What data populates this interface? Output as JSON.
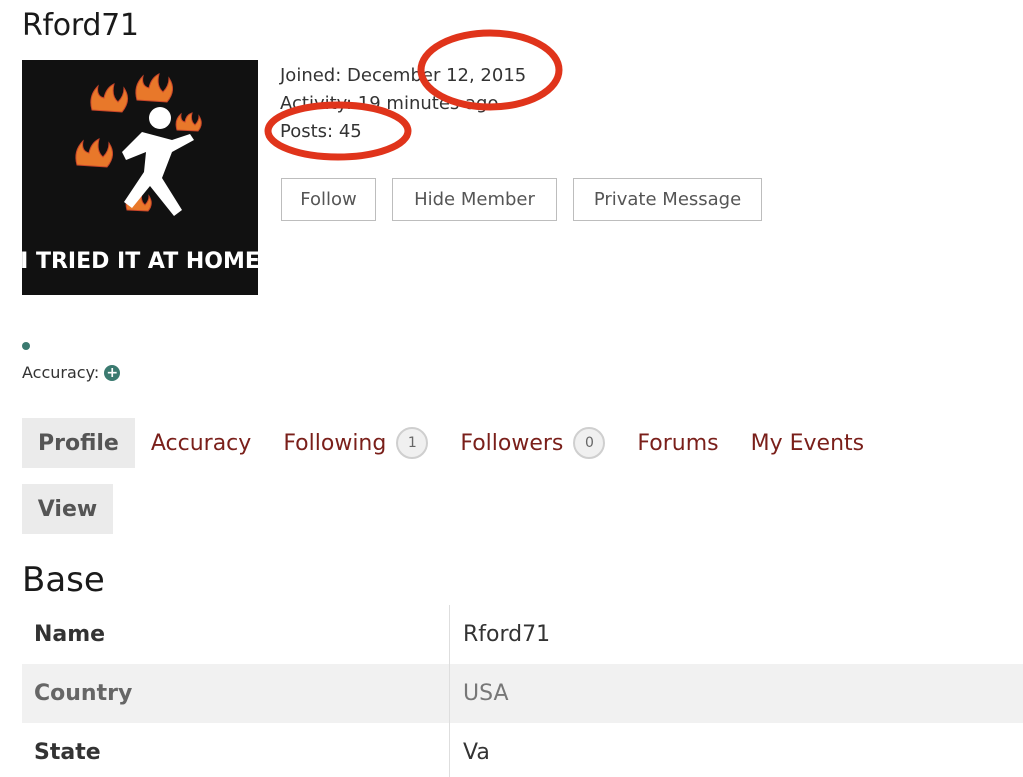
{
  "profile": {
    "username": "Rford71",
    "avatar_text": "I TRIED IT AT HOME",
    "joined": "Joined: December 12, 2015",
    "activity": "Activity: 19 minutes ago",
    "posts": "Posts: 45"
  },
  "actions": {
    "follow": "Follow",
    "hide_member": "Hide Member",
    "private_message": "Private Message"
  },
  "accuracy": {
    "label": "Accuracy:",
    "icon": "plus-circle-icon"
  },
  "tabs": {
    "profile": "Profile",
    "accuracy": "Accuracy",
    "following": "Following",
    "following_count": "1",
    "followers": "Followers",
    "followers_count": "0",
    "forums": "Forums",
    "my_events": "My Events",
    "view": "View"
  },
  "base": {
    "title": "Base",
    "rows": [
      {
        "key": "Name",
        "value": "Rford71"
      },
      {
        "key": "Country",
        "value": "USA"
      },
      {
        "key": "State",
        "value": "Va"
      }
    ]
  },
  "colors": {
    "accent_link": "#7a1f1a",
    "status": "#3b7a70",
    "annotation": "#e0341b"
  }
}
